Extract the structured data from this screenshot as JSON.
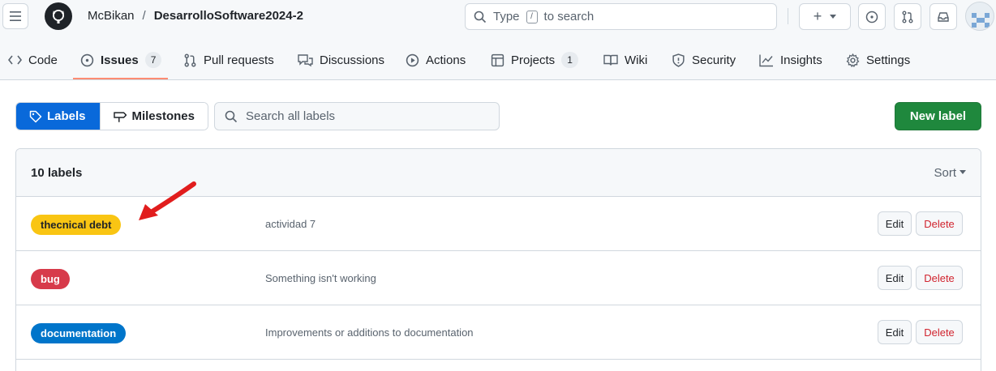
{
  "header": {
    "owner": "McBikan",
    "separator": "/",
    "repo": "DesarrolloSoftware2024-2",
    "search_prefix": "Type",
    "search_slash": "/",
    "search_suffix": "to search",
    "plus_symbol": "+"
  },
  "tabs": [
    {
      "label": "Code",
      "icon": "code-icon"
    },
    {
      "label": "Issues",
      "icon": "issue-icon",
      "count": "7",
      "active": true
    },
    {
      "label": "Pull requests",
      "icon": "pull-request-icon"
    },
    {
      "label": "Discussions",
      "icon": "discussion-icon"
    },
    {
      "label": "Actions",
      "icon": "play-icon"
    },
    {
      "label": "Projects",
      "icon": "table-icon",
      "count": "1"
    },
    {
      "label": "Wiki",
      "icon": "book-icon"
    },
    {
      "label": "Security",
      "icon": "shield-icon"
    },
    {
      "label": "Insights",
      "icon": "graph-icon"
    },
    {
      "label": "Settings",
      "icon": "gear-icon"
    }
  ],
  "subnav": {
    "labels": "Labels",
    "milestones": "Milestones",
    "search_placeholder": "Search all labels",
    "new_label": "New label"
  },
  "list": {
    "count_text": "10 labels",
    "sort": "Sort",
    "labels": [
      {
        "name": "thecnical debt",
        "description": "actividad 7",
        "color": "#f9c513",
        "text_color": "#1f2328"
      },
      {
        "name": "bug",
        "description": "Something isn't working",
        "color": "#d73a4a",
        "text_color": "#ffffff"
      },
      {
        "name": "documentation",
        "description": "Improvements or additions to documentation",
        "color": "#0075ca",
        "text_color": "#ffffff"
      }
    ],
    "edit_label": "Edit",
    "delete_label": "Delete"
  },
  "colors": {
    "accent": "#0969da",
    "primary_button": "#1f883d",
    "active_tab_underline": "#fd8c73",
    "annotation_arrow": "#e11d1d"
  }
}
